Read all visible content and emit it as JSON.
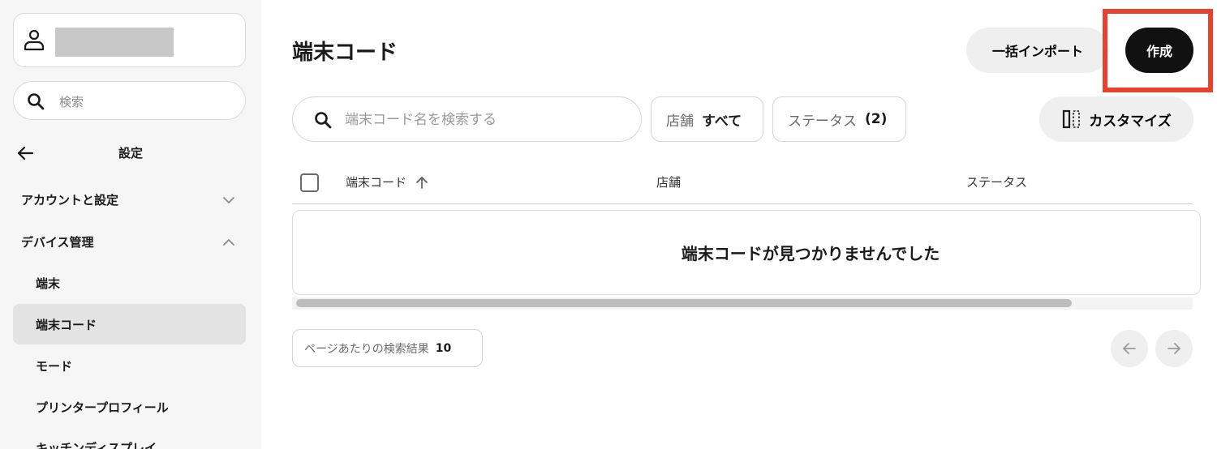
{
  "sidebar": {
    "account": {
      "icon": "user-icon"
    },
    "search": {
      "placeholder": "検索",
      "icon": "search-icon"
    },
    "back": {
      "title": "設定",
      "icon": "arrow-left-icon"
    },
    "groups": [
      {
        "label": "アカウントと設定",
        "expanded": false,
        "icon": "chevron-down-icon"
      },
      {
        "label": "デバイス管理",
        "expanded": true,
        "icon": "chevron-up-icon"
      }
    ],
    "items": [
      {
        "label": "端末",
        "active": false
      },
      {
        "label": "端末コード",
        "active": true
      },
      {
        "label": "モード",
        "active": false
      },
      {
        "label": "プリンタープロフィール",
        "active": false
      },
      {
        "label": "キッチンディスプレイ",
        "active": false
      }
    ]
  },
  "header": {
    "title": "端末コード",
    "import_label": "一括インポート",
    "create_label": "作成",
    "highlight_color": "#e8412c"
  },
  "toolbar": {
    "search_placeholder": "端末コード名を検索する",
    "store_filter": {
      "key": "店舗",
      "value": "すべて"
    },
    "status_filter": {
      "key": "ステータス",
      "value": "(2)"
    },
    "customize_label": "カスタマイズ",
    "customize_icon": "columns-icon"
  },
  "table": {
    "columns": [
      "端末コード",
      "店舗",
      "ステータス"
    ],
    "sort_icon": "arrow-up-icon",
    "empty_message": "端末コードが見つかりませんでした"
  },
  "pagination": {
    "per_page_label": "ページあたりの検索結果",
    "per_page_value": "10",
    "prev_icon": "arrow-left-icon",
    "next_icon": "arrow-right-icon"
  }
}
